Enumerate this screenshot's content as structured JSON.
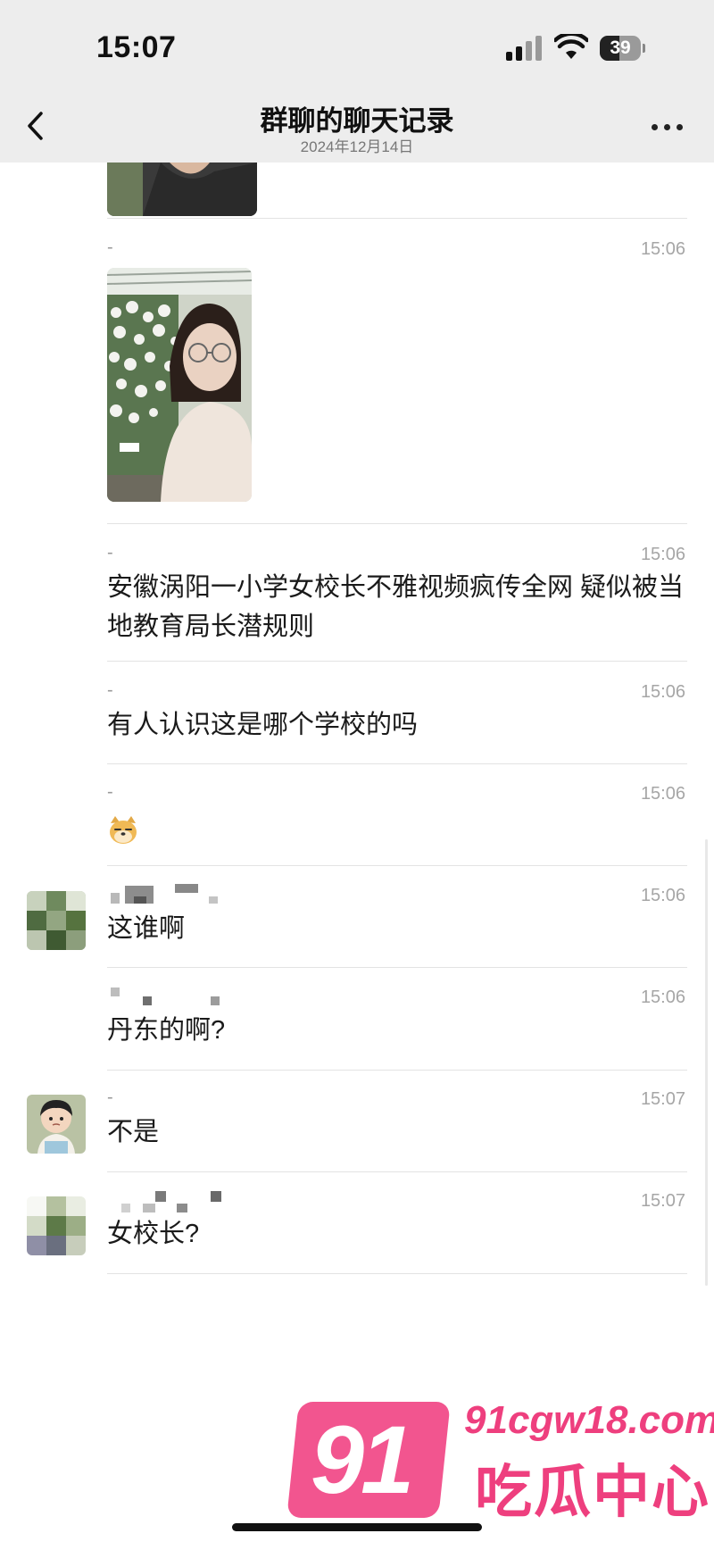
{
  "status_bar": {
    "time": "15:07",
    "battery": "39"
  },
  "nav": {
    "title": "群聊的聊天记录",
    "subtitle": "2024年12月14日"
  },
  "messages": [
    {
      "sender": "-",
      "time": "15:06",
      "type": "image"
    },
    {
      "sender": "-",
      "time": "15:06",
      "type": "text",
      "text": "安徽涡阳一小学女校长不雅视频疯传全网 疑似被当地教育局长潜规则"
    },
    {
      "sender": "-",
      "time": "15:06",
      "type": "text",
      "text": "有人认识这是哪个学校的吗"
    },
    {
      "sender": "-",
      "time": "15:06",
      "type": "emoji",
      "emoji_icon": "doge-emoji-icon"
    },
    {
      "sender": "",
      "time": "15:06",
      "type": "text",
      "text": "这谁啊"
    },
    {
      "sender": "",
      "time": "15:06",
      "type": "text",
      "text": "丹东的啊?"
    },
    {
      "sender": "-",
      "time": "15:07",
      "type": "text",
      "text": "不是"
    },
    {
      "sender": "",
      "time": "15:07",
      "type": "text",
      "text": "女校长?"
    }
  ],
  "watermark": {
    "number": "91",
    "url": "91cgw18.com",
    "name": "吃瓜中心",
    "color": "#ee3f7e"
  },
  "colors": {
    "bar_bg": "#ededed",
    "divider": "#e3e3e3",
    "timestamp": "#a6a6a6"
  }
}
